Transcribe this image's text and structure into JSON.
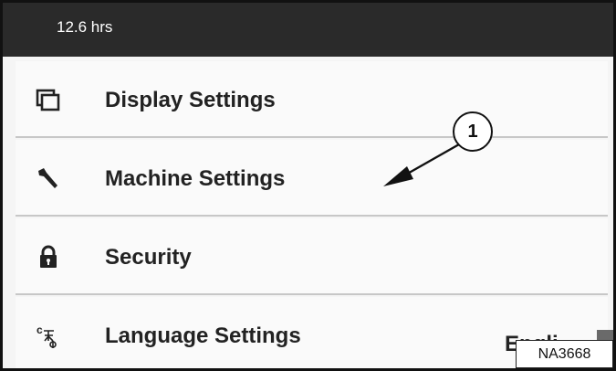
{
  "status_bar": {
    "hours": "12.6 hrs"
  },
  "menu": {
    "items": [
      {
        "label": "Display Settings",
        "icon": "display-icon"
      },
      {
        "label": "Machine Settings",
        "icon": "wrench-icon"
      },
      {
        "label": "Security",
        "icon": "lock-icon"
      },
      {
        "label": "Language Settings",
        "icon": "language-icon",
        "value": "Engli"
      }
    ]
  },
  "callout": {
    "number": "1"
  },
  "figure_tag": {
    "code": "NA3668"
  },
  "colors": {
    "topbar": "#2a2a2a",
    "menu_background": "#fafafa",
    "separator": "#c7c7c7"
  }
}
